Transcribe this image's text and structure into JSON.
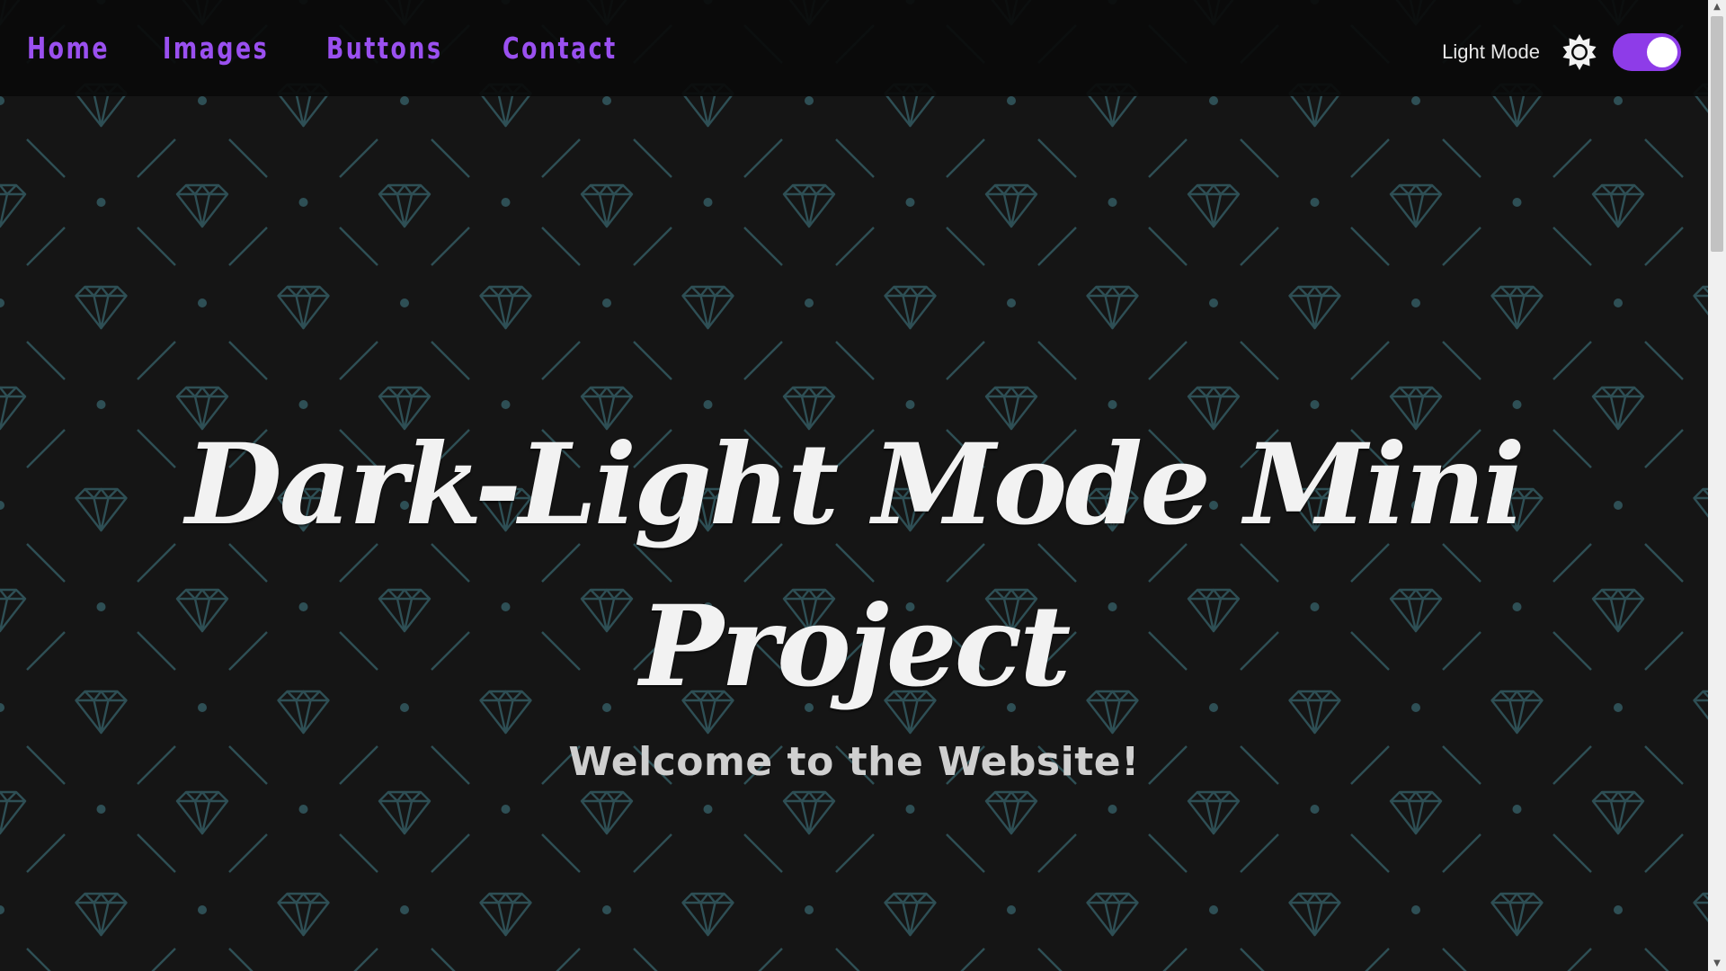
{
  "nav": {
    "items": [
      {
        "label": "Home"
      },
      {
        "label": "Images"
      },
      {
        "label": "Buttons"
      },
      {
        "label": "Contact"
      }
    ]
  },
  "theme_switch": {
    "label": "Light Mode",
    "icon": "sun-icon",
    "checked": true
  },
  "hero": {
    "title": "Dark-Light Mode Mini Project",
    "subtitle": "Welcome to the Website!"
  },
  "colors": {
    "background": "#151515",
    "navbar": "#0a0a0a",
    "accent": "#9a50f0",
    "pattern": "#2e4f55",
    "text": "#f2f2f2"
  }
}
